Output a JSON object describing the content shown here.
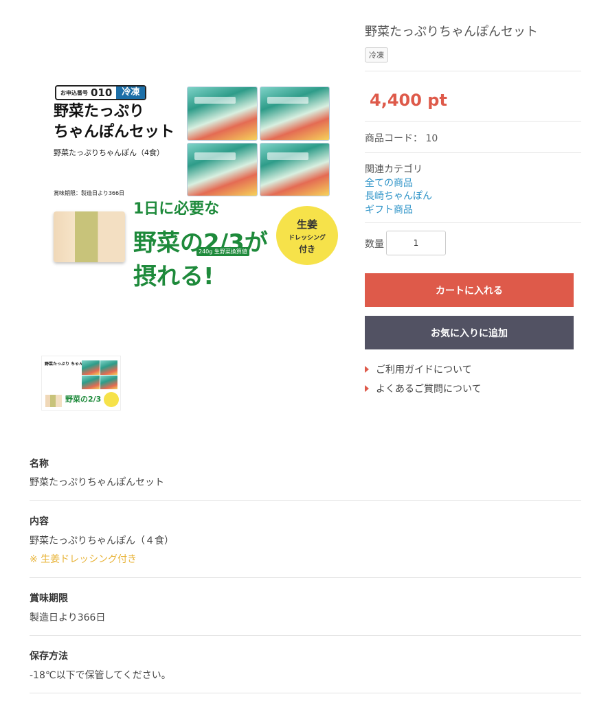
{
  "image": {
    "order_label": "お申込番号",
    "order_number": "010",
    "frozen_tag": "冷凍",
    "title_line1": "野菜たっぷり",
    "title_line2": "ちゃんぽんセット",
    "subtitle": "野菜たっぷりちゃんぽん（4食）",
    "expiry_note": "賞味期限：製造日より366日",
    "veg_line1": "1日に必要な",
    "veg_line2": "野菜の2/3が摂れる!",
    "veg_badge": "240g 生野菜換算値",
    "ginger_line1": "生姜",
    "ginger_line2": "ドレッシング",
    "ginger_line3": "付き",
    "thumb_title": "野菜たっぷり ちゃんぽんセット",
    "thumb_veg": "野菜の2/3"
  },
  "product": {
    "title": "野菜たっぷりちゃんぽんセット",
    "badge": "冷凍",
    "price": "4,400 pt",
    "code": "商品コード： 10",
    "category_label": "関連カテゴリ",
    "categories": [
      "全ての商品",
      "長崎ちゃんぽん",
      "ギフト商品"
    ],
    "quantity_label": "数量",
    "quantity_value": "1",
    "cart_button": "カートに入れる",
    "favorite_button": "お気に入りに追加",
    "links": [
      "ご利用ガイドについて",
      "よくあるご質問について"
    ]
  },
  "specs": [
    {
      "heading": "名称",
      "value": "野菜たっぷりちゃんぽんセット"
    },
    {
      "heading": "内容",
      "value": "野菜たっぷりちゃんぽん（４食）",
      "note": "※ 生姜ドレッシング付き"
    },
    {
      "heading": "賞味期限",
      "value": "製造日より366日"
    },
    {
      "heading": "保存方法",
      "value": "-18℃以下で保管してください。"
    }
  ],
  "colors": {
    "accent": "#de5a4a",
    "dark_button": "#525263",
    "link": "#2f94c8",
    "note": "#e8b43a"
  }
}
